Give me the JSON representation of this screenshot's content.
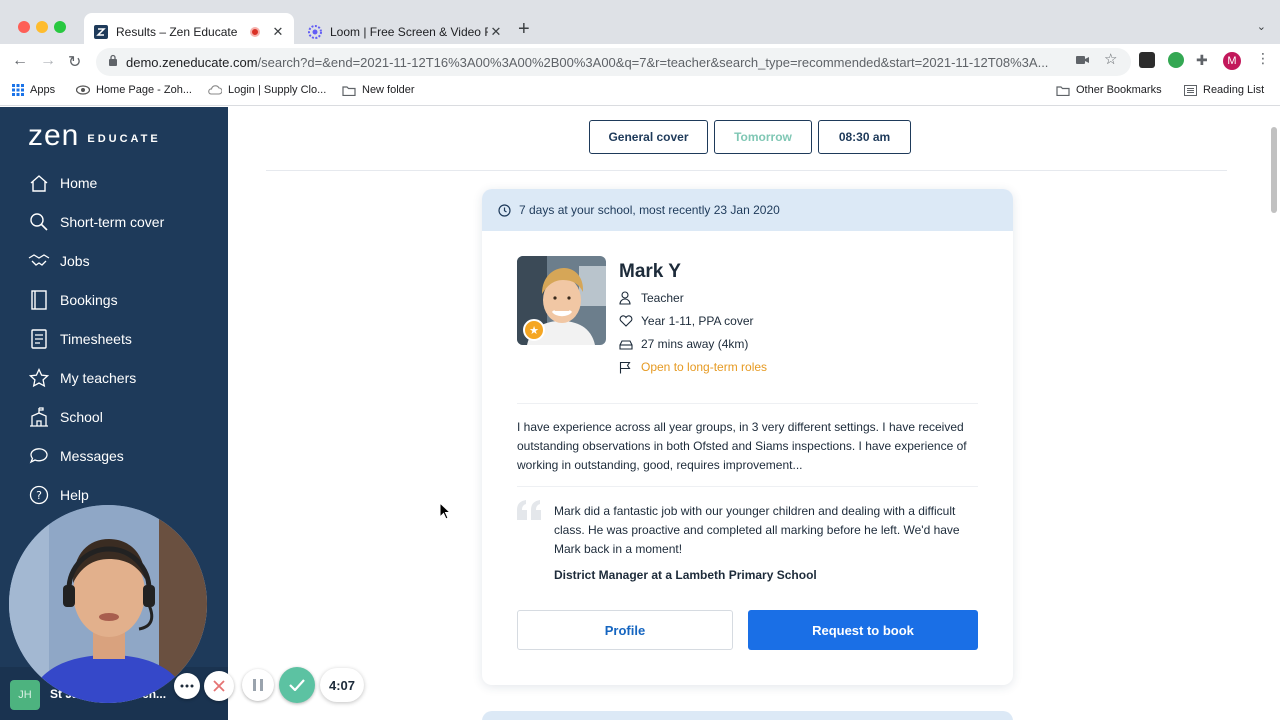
{
  "browser": {
    "tabs": [
      {
        "title": "Results – Zen Educate",
        "active": true
      },
      {
        "title": "Loom | Free Screen & Video Re",
        "active": false
      }
    ],
    "url_host": "demo.zeneducate.com",
    "url_rest": "/search?d=&end=2021-11-12T16%3A00%3A00%2B00%3A00&q=7&r=teacher&search_type=recommended&start=2021-11-12T08%3A...",
    "profile_initial": "M",
    "bookmarks": {
      "apps": "Apps",
      "items": [
        "Home Page - Zoh...",
        "Login | Supply Clo...",
        "New folder"
      ],
      "other": "Other Bookmarks",
      "reading_list": "Reading List"
    }
  },
  "sidebar": {
    "logo_main": "zen",
    "logo_sub": "EDUCATE",
    "items": [
      {
        "label": "Home",
        "icon": "home-icon"
      },
      {
        "label": "Short-term cover",
        "icon": "search-icon"
      },
      {
        "label": "Jobs",
        "icon": "handshake-icon"
      },
      {
        "label": "Bookings",
        "icon": "bookings-icon"
      },
      {
        "label": "Timesheets",
        "icon": "timesheet-icon"
      },
      {
        "label": "My teachers",
        "icon": "star-icon"
      },
      {
        "label": "School",
        "icon": "school-icon"
      },
      {
        "label": "Messages",
        "icon": "chat-icon"
      },
      {
        "label": "Help",
        "icon": "help-icon"
      }
    ],
    "school": {
      "initials": "JH",
      "name": "St Ja...   ...mary Sch..."
    }
  },
  "filters": {
    "cover_type": "General cover",
    "day": "Tomorrow",
    "time": "08:30 am"
  },
  "card": {
    "history": "7 days at your school, most recently 23 Jan 2020",
    "name": "Mark Y",
    "role": "Teacher",
    "years": "Year 1-11, PPA cover",
    "distance": "27 mins away (4km)",
    "long_term": "Open to long-term roles",
    "bio": "I have experience across all year groups, in 3 very different settings. I have received outstanding observations in both Ofsted and Siams inspections. I have experience of working in outstanding, good, requires improvement...",
    "quote": "Mark did a fantastic job with our younger children and dealing with a difficult class. He was proactive and completed all marking before he left. We'd have Mark back in a moment!",
    "quote_author": "District Manager at a Lambeth Primary School",
    "profile_button": "Profile",
    "book_button": "Request to book"
  },
  "recorder": {
    "timer": "4:07"
  },
  "colors": {
    "sidebar": "#1e3a5a",
    "accent_blue": "#1a6fe6",
    "orange": "#e69a22",
    "teal": "#7fc7b4",
    "card_header": "#dce9f6"
  }
}
